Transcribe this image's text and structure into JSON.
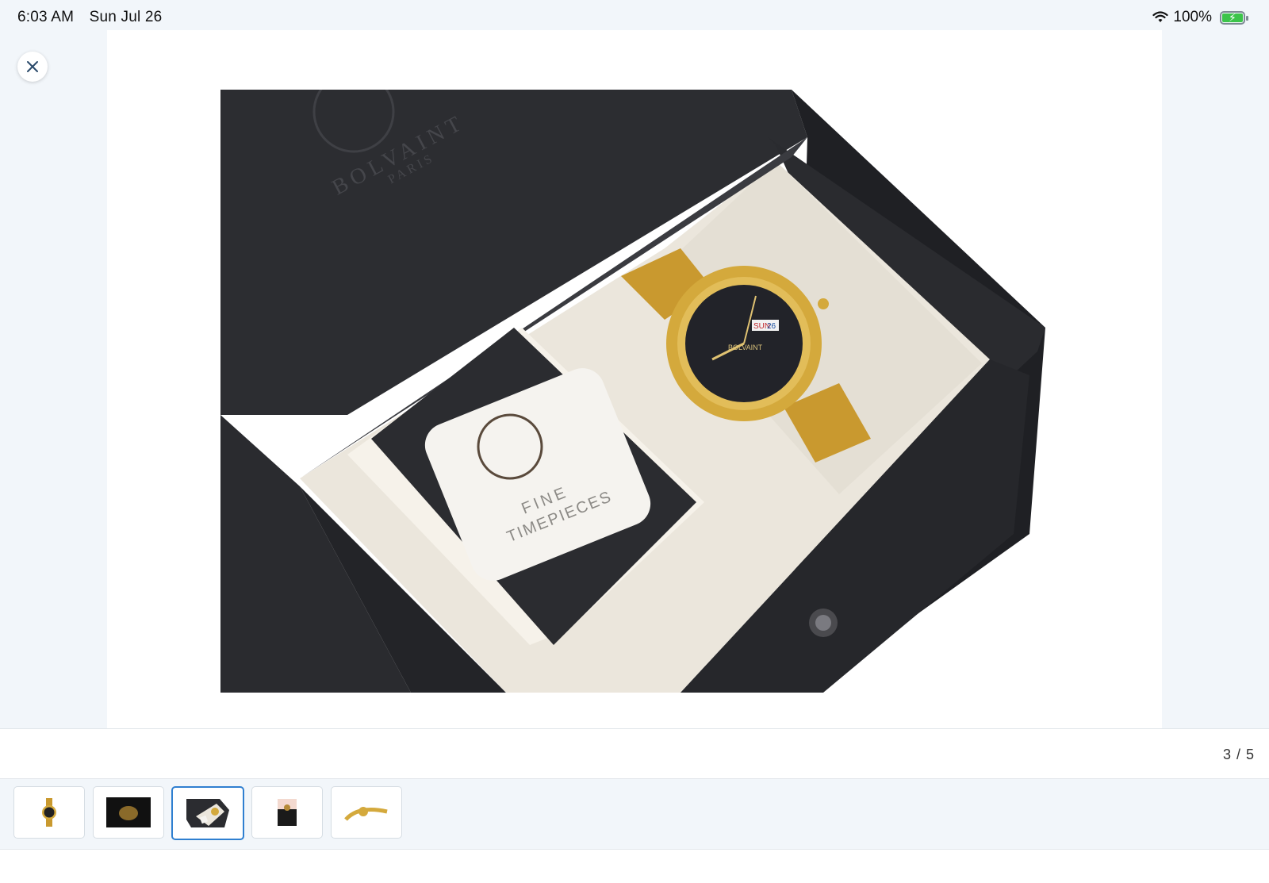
{
  "status": {
    "time": "6:03 AM",
    "date": "Sun Jul 26",
    "battery": "100%",
    "battery_level": 1.0
  },
  "viewer": {
    "close_icon": "close-icon",
    "counter": "3 / 5",
    "current_index": 3,
    "total": 5
  },
  "product_image": {
    "box_brand": "BOLVAINT",
    "box_subbrand": "PARIS",
    "card_line1": "FINE",
    "card_line2": "TIMEPIECES",
    "watch_brand": "BOLVAINT",
    "day_window": "SUN",
    "date_window": "26"
  },
  "thumbnails": [
    {
      "label": "watch-front"
    },
    {
      "label": "watch-dark"
    },
    {
      "label": "gift-box",
      "active": true
    },
    {
      "label": "on-wrist"
    },
    {
      "label": "watch-side"
    }
  ],
  "colors": {
    "accent": "#2f7fd0",
    "battery": "#3cc44a",
    "gold": "#d4a93c",
    "box": "#2b2c30"
  }
}
